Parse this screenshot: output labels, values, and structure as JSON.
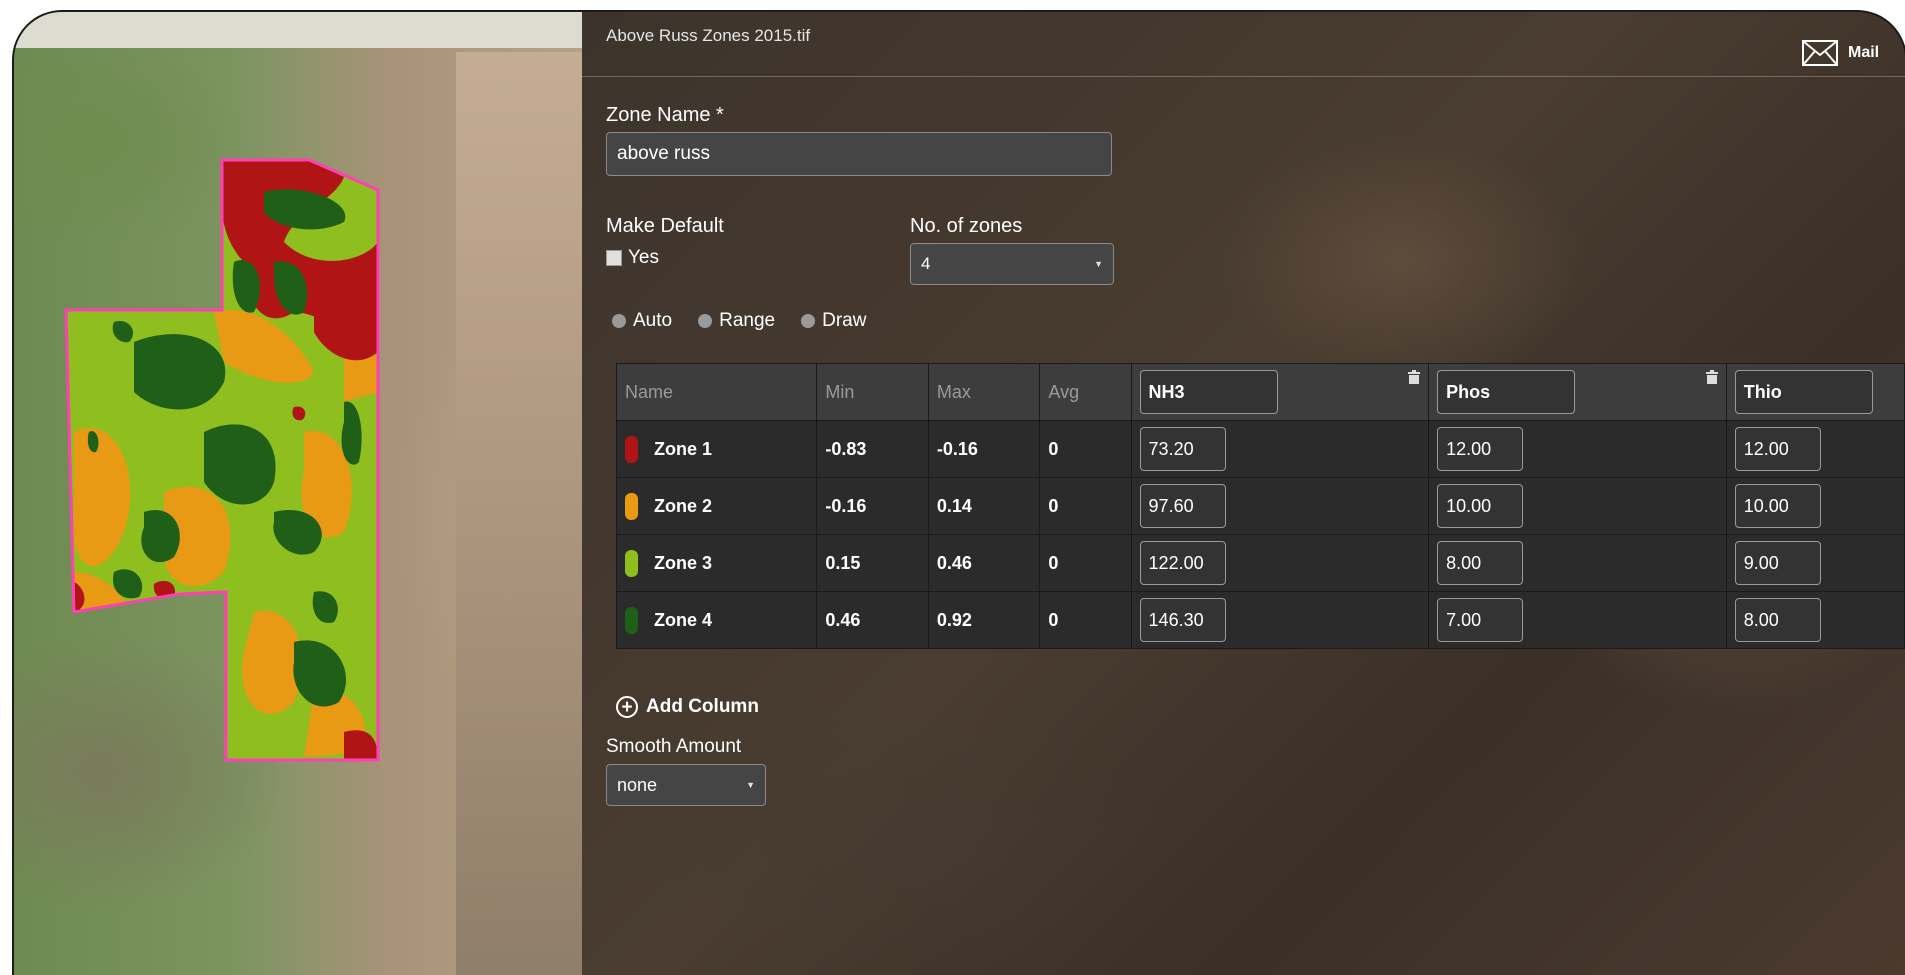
{
  "window": {
    "file_name": "Above Russ Zones 2015.tif",
    "mail_label": "Mail"
  },
  "form": {
    "zone_name_label": "Zone Name *",
    "zone_name_value": "above russ",
    "make_default_label": "Make Default",
    "make_default_option": "Yes",
    "make_default_checked": false,
    "num_zones_label": "No. of zones",
    "num_zones_value": "4",
    "modes": [
      "Auto",
      "Range",
      "Draw"
    ],
    "add_column_label": "Add Column",
    "smooth_label": "Smooth Amount",
    "smooth_value": "none"
  },
  "table": {
    "headers": {
      "name": "Name",
      "min": "Min",
      "max": "Max",
      "avg": "Avg"
    },
    "products": [
      "NH3",
      "Phos",
      "Thio"
    ],
    "rows": [
      {
        "name": "Zone 1",
        "color": "#b01414",
        "min": "-0.83",
        "max": "-0.16",
        "avg": "0",
        "values": [
          "73.20",
          "12.00",
          "12.00"
        ]
      },
      {
        "name": "Zone 2",
        "color": "#e89a14",
        "min": "-0.16",
        "max": "0.14",
        "avg": "0",
        "values": [
          "97.60",
          "10.00",
          "10.00"
        ]
      },
      {
        "name": "Zone 3",
        "color": "#8fbf1e",
        "min": "0.15",
        "max": "0.46",
        "avg": "0",
        "values": [
          "122.00",
          "8.00",
          "9.00"
        ]
      },
      {
        "name": "Zone 4",
        "color": "#1f5f17",
        "min": "0.46",
        "max": "0.92",
        "avg": "0",
        "values": [
          "146.30",
          "7.00",
          "8.00"
        ]
      }
    ]
  },
  "colors": {
    "zone_outline": "#ff3fb4",
    "zone1": "#b01414",
    "zone2": "#e89a14",
    "zone3": "#8fbf1e",
    "zone4": "#1f5f17"
  }
}
